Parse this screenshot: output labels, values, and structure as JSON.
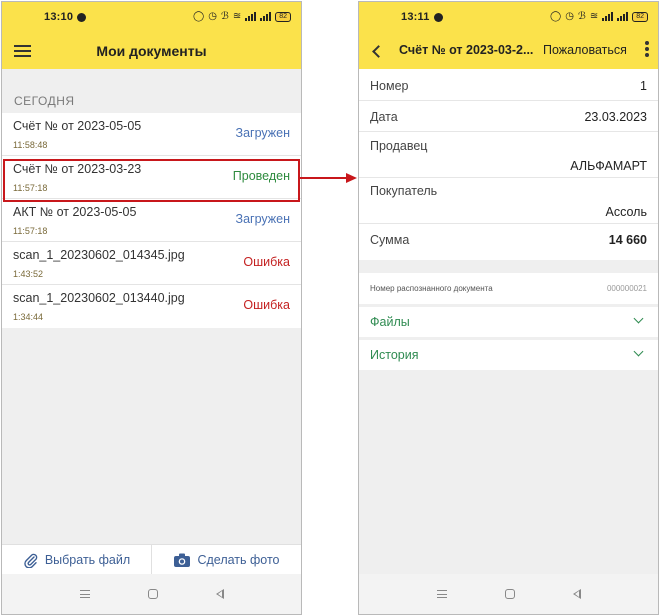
{
  "left_phone": {
    "status": {
      "time": "13:10",
      "battery": "82"
    },
    "title": "Мои документы",
    "section": "СЕГОДНЯ",
    "documents": [
      {
        "name": "Счёт №  от 2023-05-05",
        "time": "11:58:48",
        "status": "Загружен"
      },
      {
        "name": "Счёт №  от 2023-03-23",
        "time": "11:57:18",
        "status": "Проведен"
      },
      {
        "name": "АКТ №  от 2023-05-05",
        "time": "11:57:18",
        "status": "Загружен"
      },
      {
        "name": "scan_1_20230602_014345.jpg",
        "time": "1:43:52",
        "status": "Ошибка"
      },
      {
        "name": "scan_1_20230602_013440.jpg",
        "time": "1:34:44",
        "status": "Ошибка"
      }
    ],
    "actions": {
      "choose_file": "Выбрать файл",
      "take_photo": "Сделать фото"
    }
  },
  "right_phone": {
    "status": {
      "time": "13:11",
      "battery": "82"
    },
    "title": "Счёт №  от 2023-03-2...",
    "complain": "Пожаловаться",
    "fields": {
      "number": {
        "label": "Номер",
        "value": "1"
      },
      "date": {
        "label": "Дата",
        "value": "23.03.2023"
      },
      "seller": {
        "label": "Продавец",
        "value": "АЛЬФАМАРТ"
      },
      "buyer": {
        "label": "Покупатель",
        "value": "Ассоль"
      },
      "sum": {
        "label": "Сумма",
        "value": "14 660"
      }
    },
    "recognized": {
      "label": "Номер распознанного документа",
      "value": "000000021"
    },
    "sections": {
      "files": "Файлы",
      "history": "История"
    }
  },
  "colors": {
    "appbar": "#fbe24b",
    "loaded": "#4a72b5",
    "posted": "#2e8b3e",
    "error": "#c42121",
    "highlight": "#c8171b",
    "link_green": "#2f8b51"
  }
}
